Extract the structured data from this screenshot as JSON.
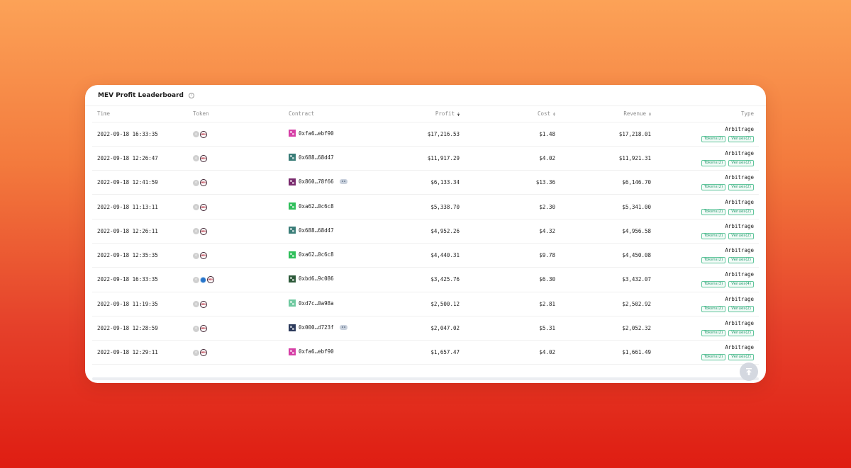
{
  "title": "MEV Profit Leaderboard",
  "columns": {
    "time": "Time",
    "token": "Token",
    "contract": "Contract",
    "profit": "Profit",
    "cost": "Cost",
    "revenue": "Revenue",
    "type": "Type"
  },
  "rows": [
    {
      "time": "2022-09-18 16:33:35",
      "tokens": [
        "eth-icon",
        "mev-icon"
      ],
      "contract": "0xfa6…ebf90",
      "avatar_color": "#d63fa6",
      "robot": false,
      "profit": "$17,216.53",
      "cost": "$1.48",
      "revenue": "$17,218.01",
      "type": "Arbitrage",
      "tokens_tag": "Tokens(2)",
      "venues_tag": "Venues(2)"
    },
    {
      "time": "2022-09-18 12:26:47",
      "tokens": [
        "eth-icon",
        "mev-icon"
      ],
      "contract": "0x688…68d47",
      "avatar_color": "#3a7d78",
      "robot": false,
      "profit": "$11,917.29",
      "cost": "$4.02",
      "revenue": "$11,921.31",
      "type": "Arbitrage",
      "tokens_tag": "Tokens(2)",
      "venues_tag": "Venues(2)"
    },
    {
      "time": "2022-09-18 12:41:59",
      "tokens": [
        "eth-icon",
        "mev-icon"
      ],
      "contract": "0x860…78f66",
      "avatar_color": "#7a2b6e",
      "robot": true,
      "profit": "$6,133.34",
      "cost": "$13.36",
      "revenue": "$6,146.70",
      "type": "Arbitrage",
      "tokens_tag": "Tokens(2)",
      "venues_tag": "Venues(2)"
    },
    {
      "time": "2022-09-18 11:13:11",
      "tokens": [
        "eth-icon",
        "mev-icon"
      ],
      "contract": "0xa62…0c6c8",
      "avatar_color": "#2fbf5a",
      "robot": false,
      "profit": "$5,338.70",
      "cost": "$2.30",
      "revenue": "$5,341.00",
      "type": "Arbitrage",
      "tokens_tag": "Tokens(2)",
      "venues_tag": "Venues(2)"
    },
    {
      "time": "2022-09-18 12:26:11",
      "tokens": [
        "eth-icon",
        "mev-icon"
      ],
      "contract": "0x688…68d47",
      "avatar_color": "#3a7d78",
      "robot": false,
      "profit": "$4,952.26",
      "cost": "$4.32",
      "revenue": "$4,956.58",
      "type": "Arbitrage",
      "tokens_tag": "Tokens(2)",
      "venues_tag": "Venues(2)"
    },
    {
      "time": "2022-09-18 12:35:35",
      "tokens": [
        "eth-icon",
        "mev-icon"
      ],
      "contract": "0xa62…0c6c8",
      "avatar_color": "#2fbf5a",
      "robot": false,
      "profit": "$4,440.31",
      "cost": "$9.78",
      "revenue": "$4,450.08",
      "type": "Arbitrage",
      "tokens_tag": "Tokens(2)",
      "venues_tag": "Venues(2)"
    },
    {
      "time": "2022-09-18 16:33:35",
      "tokens": [
        "eth-icon",
        "usdc-icon",
        "mev-icon"
      ],
      "contract": "0xbd6…9c086",
      "avatar_color": "#2d5a3a",
      "robot": false,
      "profit": "$3,425.76",
      "cost": "$6.30",
      "revenue": "$3,432.07",
      "type": "Arbitrage",
      "tokens_tag": "Tokens(3)",
      "venues_tag": "Venues(4)"
    },
    {
      "time": "2022-09-18 11:19:35",
      "tokens": [
        "eth-icon",
        "mev-icon"
      ],
      "contract": "0xd7c…0a98a",
      "avatar_color": "#6fc9a0",
      "robot": false,
      "profit": "$2,500.12",
      "cost": "$2.81",
      "revenue": "$2,502.92",
      "type": "Arbitrage",
      "tokens_tag": "Tokens(2)",
      "venues_tag": "Venues(2)"
    },
    {
      "time": "2022-09-18 12:28:59",
      "tokens": [
        "eth-icon",
        "mev-icon"
      ],
      "contract": "0x000…d723f",
      "avatar_color": "#2c3a5c",
      "robot": true,
      "profit": "$2,047.02",
      "cost": "$5.31",
      "revenue": "$2,052.32",
      "type": "Arbitrage",
      "tokens_tag": "Tokens(2)",
      "venues_tag": "Venues(2)"
    },
    {
      "time": "2022-09-18 12:29:11",
      "tokens": [
        "eth-icon",
        "mev-icon"
      ],
      "contract": "0xfa6…ebf90",
      "avatar_color": "#d63fa6",
      "robot": false,
      "profit": "$1,657.47",
      "cost": "$4.02",
      "revenue": "$1,661.49",
      "type": "Arbitrage",
      "tokens_tag": "Tokens(2)",
      "venues_tag": "Venues(2)"
    }
  ],
  "colors": {
    "tag_green": "#1f9a6c",
    "background_top": "#fca257",
    "background_bottom": "#df1d12"
  }
}
